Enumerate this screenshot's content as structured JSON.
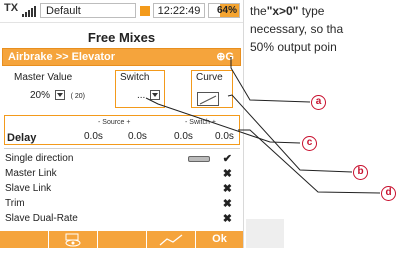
{
  "status": {
    "tx_label": "TX",
    "model_name": "Default",
    "time": "12:22:49",
    "battery": "64%",
    "battery_fraction": 0.64,
    "accent": "#f39a1b"
  },
  "screen_title": "Free Mixes",
  "mix": {
    "name": "Airbrake >> Elevator",
    "icon": "mix-toggle-icon"
  },
  "master": {
    "label": "Master Value",
    "value": "20%",
    "sub": "( 20)"
  },
  "switch": {
    "label": "Switch",
    "value": "..."
  },
  "curve": {
    "label": "Curve"
  },
  "delay": {
    "label": "Delay",
    "source_header": "- Source +",
    "switch_header": "- Switch +",
    "values": [
      "0.0s",
      "0.0s",
      "0.0s",
      "0.0s"
    ]
  },
  "options": [
    {
      "label": "Single direction",
      "state": "✔",
      "icon": "direction-icon"
    },
    {
      "label": "Master Link",
      "state": "✖"
    },
    {
      "label": "Slave Link",
      "state": "✖"
    },
    {
      "label": "Trim",
      "state": "✖"
    },
    {
      "label": "Slave Dual-Rate",
      "state": "✖"
    }
  ],
  "softkeys": [
    "",
    "",
    "",
    "Ok"
  ],
  "annotation": {
    "line1_prefix": "the",
    "line1_bold": "\"x>0\"",
    "line1_suffix": " type",
    "line2": "necessary, so tha",
    "line3": "50% output poin"
  },
  "callouts": [
    "a",
    "b",
    "c",
    "d"
  ]
}
